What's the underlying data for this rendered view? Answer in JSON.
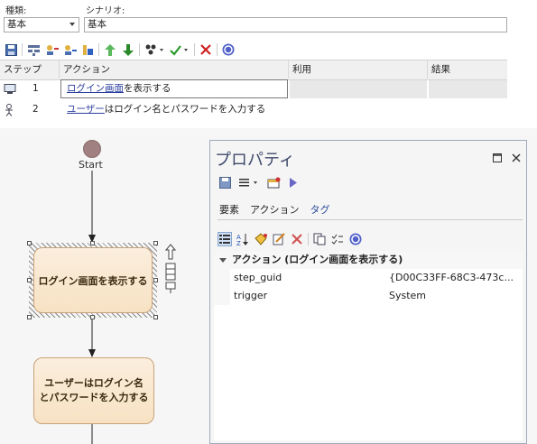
{
  "scenario_panel": {
    "type_label": "種類:",
    "type_value": "基本",
    "scenario_label": "シナリオ:",
    "scenario_value": "基本",
    "columns": [
      "ステップ",
      "アクション",
      "利用",
      "結果"
    ],
    "steps": [
      {
        "no": "1",
        "action_link": "ログイン画面",
        "action_rest": "を表示する"
      },
      {
        "no": "2",
        "action_link": "ユーザー",
        "action_rest": "はログイン名とパスワードを入力する"
      }
    ]
  },
  "diagram": {
    "start_label": "Start",
    "action1": "ログイン画面を表示する",
    "action2_line1": "ユーザーはログイン名",
    "action2_line2": "とパスワードを入力する"
  },
  "properties": {
    "title": "プロパティ",
    "tabs": [
      "要素",
      "アクション",
      "タグ"
    ],
    "active_tab": "タグ",
    "group_label": "アクション (ログイン画面を表示する)",
    "rows": [
      {
        "key": "step_guid",
        "value": "{D00C33FF-68C3-473c..."
      },
      {
        "key": "trigger",
        "value": "System"
      }
    ]
  },
  "colors": {
    "accent": "#2b3f9e",
    "action_fill": "#f7e2c3",
    "start_node": "#a08080",
    "delete_red": "#d02020",
    "check_green": "#2a9a2a"
  }
}
